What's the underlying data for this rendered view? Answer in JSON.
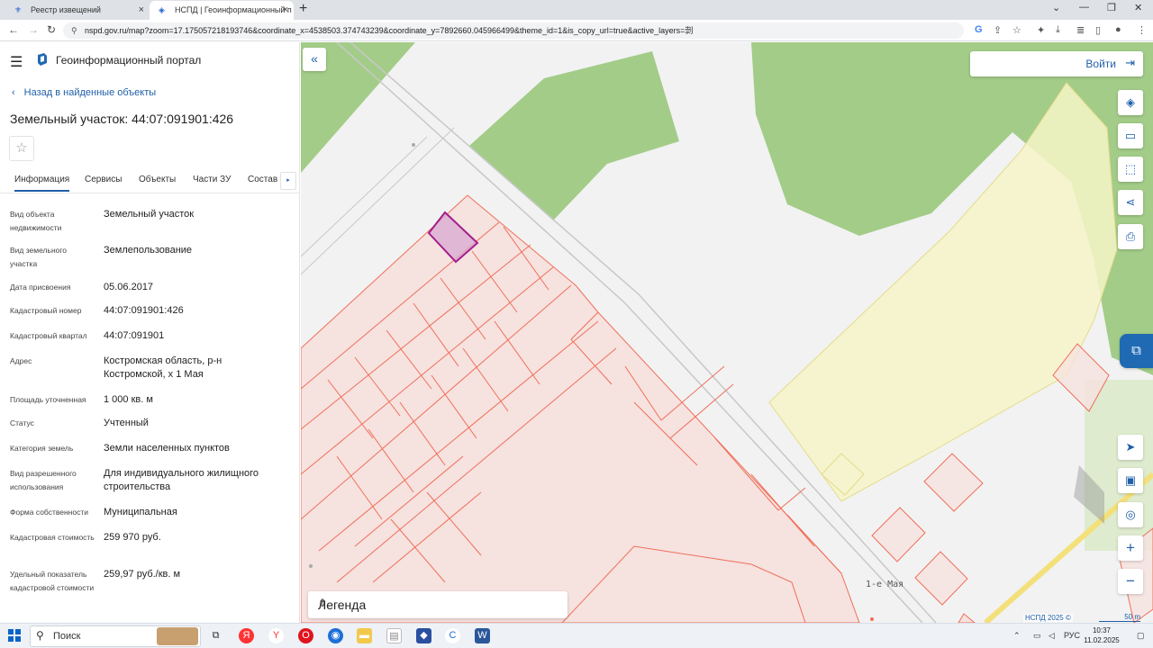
{
  "browser": {
    "tabs": [
      {
        "title": "Реестр извещений",
        "active": false
      },
      {
        "title": "НСПД | Геоинформационный п",
        "active": true
      }
    ],
    "url": "nspd.gov.ru/map?zoom=17.175057218193746&coordinate_x=4538503.374743239&coordinate_y=7892660.045966499&theme_id=1&is_copy_url=true&active_layers=㓽"
  },
  "header": {
    "portal_title": "Геоинформационный портал"
  },
  "panel": {
    "back_label": "Назад в найденные объекты",
    "object_title": "Земельный участок: 44:07:091901:426",
    "tabs": [
      "Информация",
      "Сервисы",
      "Объекты",
      "Части ЗУ",
      "Состав"
    ],
    "properties": [
      {
        "key": "Вид объекта недвижимости",
        "value": "Земельный участок"
      },
      {
        "key": "Вид земельного участка",
        "value": "Землепользование"
      },
      {
        "key": "Дата присвоения",
        "value": "05.06.2017"
      },
      {
        "key": "Кадастровый номер",
        "value": "44:07:091901:426"
      },
      {
        "key": "Кадастровый квартал",
        "value": "44:07:091901"
      },
      {
        "key": "Адрес",
        "value": "Костромская область, р-н Костромской, х 1 Мая"
      },
      {
        "key": "Площадь уточненная",
        "value": "1 000 кв. м"
      },
      {
        "key": "Статус",
        "value": "Учтенный"
      },
      {
        "key": "Категория земель",
        "value": "Земли населенных пунктов"
      },
      {
        "key": "Вид разрешенного использования",
        "value": "Для индивидуального жилищного строительства"
      },
      {
        "key": "Форма собственности",
        "value": "Муниципальная"
      },
      {
        "key": "Кадастровая стоимость",
        "value": "259 970 руб."
      },
      {
        "key": "Удельный показатель кадастровой стоимости",
        "value": "259,97 руб./кв. м"
      }
    ]
  },
  "map": {
    "login_label": "Войти",
    "legend_label": "Легенда",
    "street_label": "1-е Мая",
    "copyright": "НСПД 2025 ©",
    "scale_label": "50 m",
    "colors": {
      "green": "#a3cc88",
      "yellow": "#f7f4c8",
      "parcel_fill": "#f6e2df",
      "parcel_line": "#ef6f5a",
      "selected": "#a21e8c"
    }
  },
  "taskbar": {
    "search_label": "Поиск",
    "lang": "РУС",
    "time": "10:37",
    "date": "11.02.2025"
  }
}
